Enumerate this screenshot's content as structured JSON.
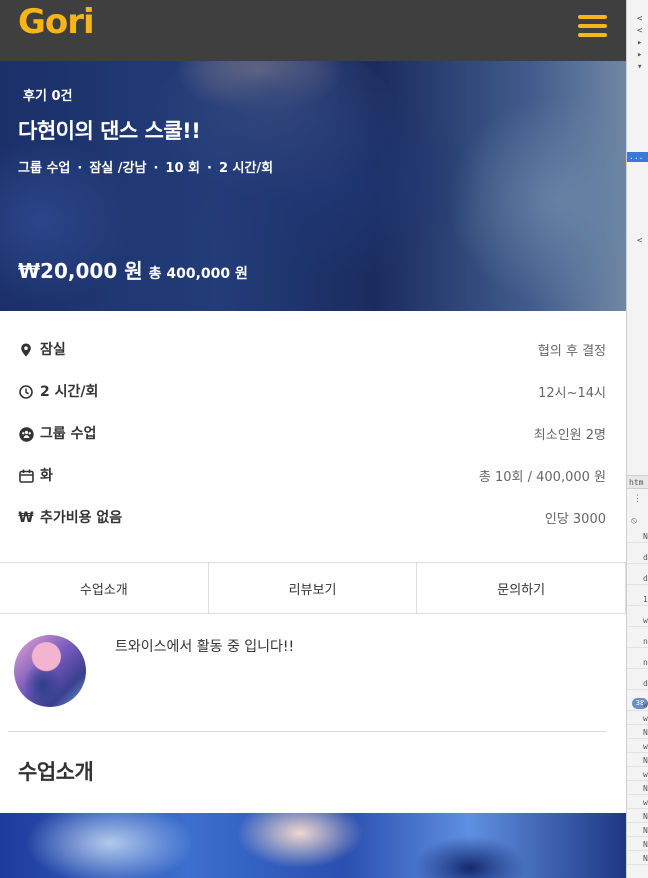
{
  "header": {
    "logo": "Gori",
    "menu_icon": "hamburger-icon",
    "accent": "#f7b51c"
  },
  "hero": {
    "review_count": "후기 0건",
    "title": "다현이의 댄스 스쿨!!",
    "meta": [
      "그룹 수업",
      "잠실 /강남",
      "10 회",
      "2 시간/회"
    ],
    "meta_separator": "·",
    "price": "₩20,000 원",
    "total": "총 400,000 원"
  },
  "info": [
    {
      "icon": "location-pin-icon",
      "label": "잠실",
      "value": "협의 후 결정"
    },
    {
      "icon": "clock-icon",
      "label": "2 시간/회",
      "value": "12시~14시"
    },
    {
      "icon": "group-icon",
      "label": "그룹 수업",
      "value": "최소인원 2명"
    },
    {
      "icon": "calendar-icon",
      "label": "화",
      "value": "총 10회 / 400,000 원"
    },
    {
      "icon": "won-icon",
      "icon_glyph": "₩",
      "label": "추가비용 없음",
      "value": "인당 3000"
    }
  ],
  "tabs": [
    "수업소개",
    "리뷰보기",
    "문의하기"
  ],
  "teacher": {
    "description": "트와이스에서 활동 중 입니다!!"
  },
  "section": {
    "title": "수업소개"
  },
  "devtools": {
    "selected_marker": "...",
    "panel_tab": "htm",
    "badge": "38",
    "console_lines": [
      "N",
      "d",
      "d",
      "1",
      "w",
      "n",
      "n",
      "d",
      "w",
      "w",
      "N",
      "w",
      "N",
      "w",
      "N",
      "w",
      "N",
      "N",
      "N",
      "N"
    ]
  }
}
